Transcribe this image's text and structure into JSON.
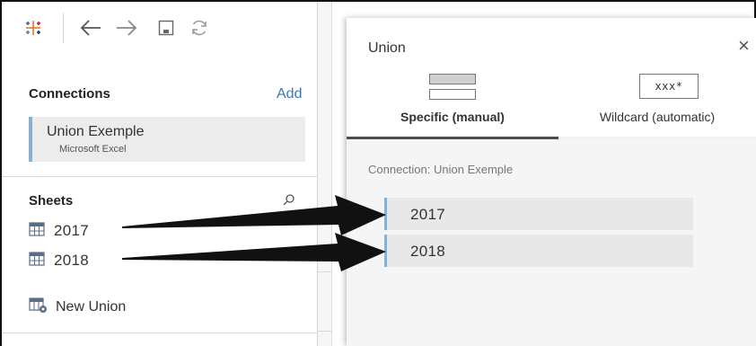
{
  "toolbar": {
    "icons": [
      "tableau-logo-icon",
      "back-arrow-icon",
      "forward-arrow-icon",
      "save-icon",
      "refresh-icon"
    ]
  },
  "connections": {
    "heading": "Connections",
    "add_label": "Add",
    "items": [
      {
        "name": "Union Exemple",
        "type": "Microsoft Excel"
      }
    ]
  },
  "sheets": {
    "heading": "Sheets",
    "items": [
      {
        "label": "2017"
      },
      {
        "label": "2018"
      }
    ],
    "new_union_label": "New Union"
  },
  "union_dialog": {
    "title": "Union",
    "close_glyph": "×",
    "tabs": [
      {
        "label": "Specific (manual)",
        "selected": true
      },
      {
        "label": "Wildcard (automatic)",
        "selected": false,
        "icon_text": "xxx*"
      }
    ],
    "connection_caption": "Connection: Union Exemple",
    "tables": [
      {
        "label": "2017"
      },
      {
        "label": "2018"
      }
    ]
  },
  "colors": {
    "accent": "#3a79b7",
    "selection_bar": "#8bb0cf",
    "item_background": "#e8e8e8",
    "arrow": "#111111"
  }
}
